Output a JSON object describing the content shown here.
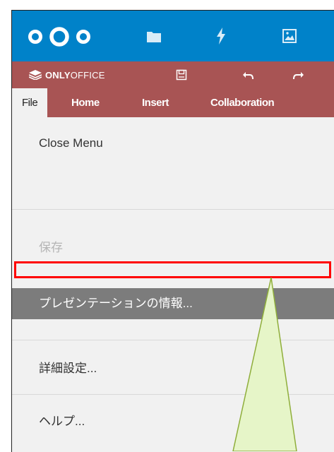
{
  "nextcloud": {
    "logo_icon": "nextcloud-logo",
    "apps": [
      "folder-icon",
      "activity-bolt-icon",
      "image-icon"
    ]
  },
  "onlyoffice": {
    "brand_prefix": "ONLY",
    "brand_suffix": "OFFICE",
    "tools": [
      "save-icon",
      "undo-icon",
      "redo-icon"
    ]
  },
  "tabs": [
    {
      "label": "File",
      "active": true
    },
    {
      "label": "Home"
    },
    {
      "label": "Insert"
    },
    {
      "label": "Collaboration"
    }
  ],
  "file_menu": [
    {
      "label": "Close Menu"
    },
    {
      "label": "保存",
      "disabled": true
    },
    {
      "label": ""
    },
    {
      "label": "プレゼンテーションの情報...",
      "selected": true
    },
    {
      "label": "詳細設定..."
    },
    {
      "label": "ヘルプ..."
    }
  ],
  "colors": {
    "nextcloud_blue": "#0082c9",
    "onlyoffice_red": "#a85454",
    "highlight_red": "#ff0000",
    "callout_fill": "#e6f5c8",
    "callout_stroke": "#8fae3b"
  }
}
